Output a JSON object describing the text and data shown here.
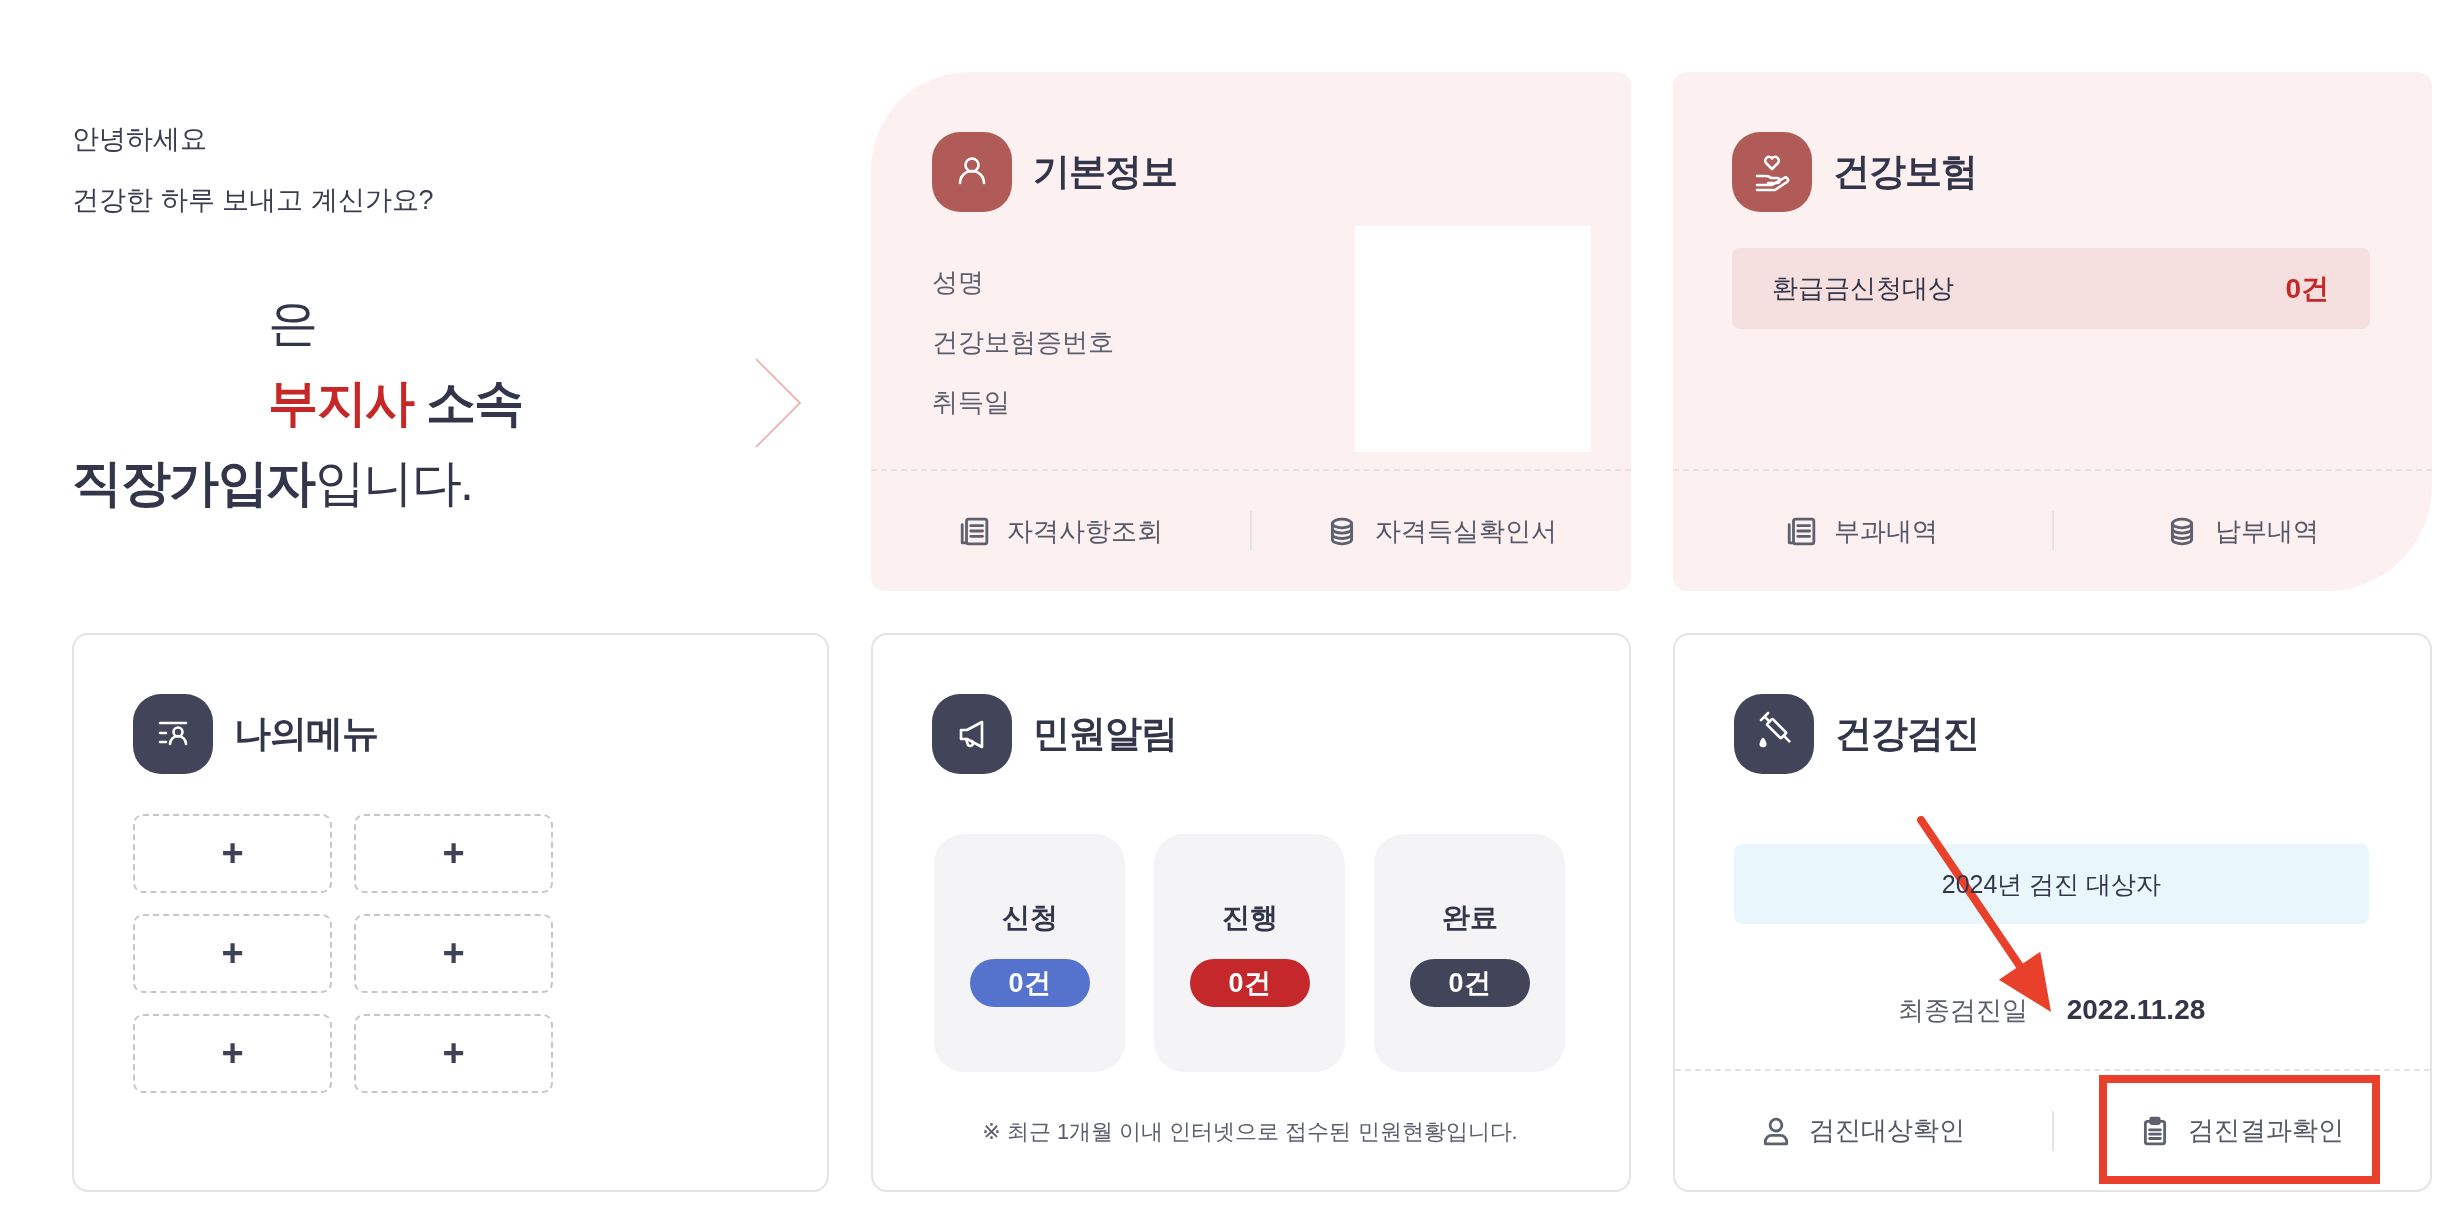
{
  "greeting": {
    "lines": [
      "안녕하세요",
      "건강한 하루 보내고 계신가요?"
    ]
  },
  "membership": {
    "lines": [
      {
        "parts": [
          {
            "kind": "blank"
          },
          {
            "text": "은",
            "kind": "plain"
          }
        ]
      },
      {
        "parts": [
          {
            "kind": "blank"
          },
          {
            "text": "부지사",
            "kind": "accent"
          },
          {
            "text": " 소속",
            "kind": "strong"
          }
        ]
      },
      {
        "parts": [
          {
            "text": "직장가입자",
            "kind": "strong"
          },
          {
            "text": "입니다.",
            "kind": "plain"
          }
        ]
      }
    ]
  },
  "cards": [
    {
      "kind": "basic_info",
      "tinted": true,
      "title": "기본정보",
      "fields": [
        "성명",
        "건강보험증번호",
        "취득일"
      ],
      "links": [
        {
          "label": "자격사항조회",
          "highlighted": false
        },
        {
          "label": "자격득실확인서",
          "highlighted": false
        }
      ]
    },
    {
      "kind": "insurance",
      "tinted": true,
      "title": "건강보험",
      "refund": {
        "label": "환급금신청대상",
        "count": "0건"
      },
      "links": [
        {
          "label": "부과내역",
          "highlighted": false
        },
        {
          "label": "납부내역",
          "highlighted": false
        }
      ]
    },
    {
      "kind": "my_menu",
      "tinted": false,
      "title": "나의메뉴",
      "slots": [
        "+",
        "+",
        "+",
        "+",
        "+",
        "+"
      ]
    },
    {
      "kind": "civil_alerts",
      "tinted": false,
      "title": "민원알림",
      "statuses": [
        {
          "label": "신청",
          "count": "0건",
          "color": "#5573cc"
        },
        {
          "label": "진행",
          "count": "0건",
          "color": "#c4282a"
        },
        {
          "label": "완료",
          "count": "0건",
          "color": "#42455a"
        }
      ],
      "note": "※ 최근 1개월 이내 인터넷으로 접수된 민원현황입니다."
    },
    {
      "kind": "checkup",
      "tinted": false,
      "title": "건강검진",
      "target_banner": "2024년 검진 대상자",
      "last_checkup": {
        "label": "최종검진일",
        "value": "2022.11.28",
        "arrow_marked": true
      },
      "links": [
        {
          "label": "검진대상확인",
          "highlighted": false
        },
        {
          "label": "검진결과확인",
          "highlighted": true
        }
      ]
    }
  ]
}
